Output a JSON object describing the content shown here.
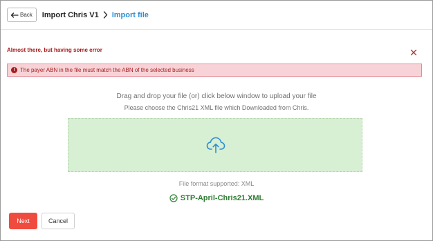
{
  "header": {
    "back_label": "Back",
    "title": "Import Chris V1",
    "current_page": "Import file"
  },
  "error": {
    "heading": "Almost there, but having some error",
    "message": "The payer ABN in the file must match the ABN of the selected business",
    "icon": "exclamation-icon"
  },
  "upload": {
    "instruction_line1": "Drag and drop your file (or) click below window to upload your file",
    "instruction_line2": "Please choose the Chris21 XML file which Downloaded from Chris.",
    "icon": "cloud-upload-icon",
    "formats": "File format supported: XML",
    "file_name": "STP-April-Chris21.XML"
  },
  "actions": {
    "next_label": "Next",
    "cancel_label": "Cancel"
  },
  "colors": {
    "accent_link": "#2e8fd0",
    "error": "#a61c1c",
    "error_bg": "#f7d3d7",
    "dropzone_bg": "#d7efd3",
    "success": "#2e7d32",
    "primary_button": "#ef4c3f"
  }
}
